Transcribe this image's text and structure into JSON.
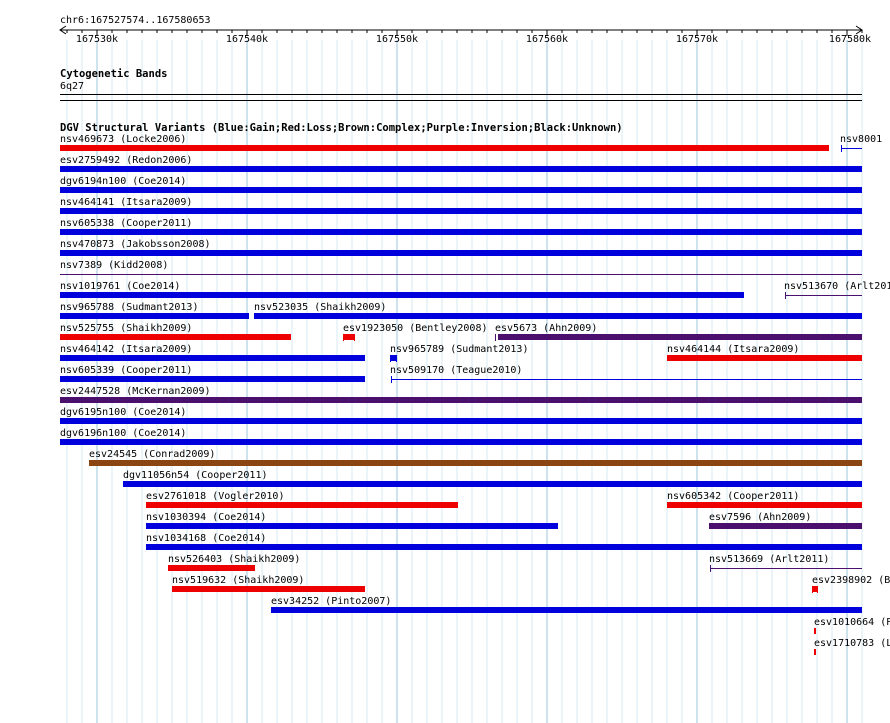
{
  "ruler": {
    "region": "chr6:167527574..167580653",
    "ticks": [
      "167530k",
      "167540k",
      "167550k",
      "167560k",
      "167570k",
      "167580k"
    ]
  },
  "cytoband": {
    "title": "Cytogenetic Bands",
    "band": "6q27"
  },
  "dgv": {
    "title": "DGV Structural Variants (Blue:Gain;Red:Loss;Brown:Complex;Purple:Inversion;Black:Unknown)",
    "features": [
      {
        "label": "nsv469673 (Locke2006)",
        "type": "loss"
      },
      {
        "label": "nsv8001",
        "type": "gain"
      },
      {
        "label": "esv2759492 (Redon2006)",
        "type": "gain"
      },
      {
        "label": "dgv6194n100 (Coe2014)",
        "type": "gain"
      },
      {
        "label": "nsv464141 (Itsara2009)",
        "type": "gain"
      },
      {
        "label": "nsv605338 (Cooper2011)",
        "type": "gain"
      },
      {
        "label": "nsv470873 (Jakobsson2008)",
        "type": "gain"
      },
      {
        "label": "nsv7389 (Kidd2008)",
        "type": "inversion"
      },
      {
        "label": "nsv1019761 (Coe2014)",
        "type": "gain"
      },
      {
        "label": "nsv513670 (Arlt201",
        "type": "inversion"
      },
      {
        "label": "nsv965788 (Sudmant2013)",
        "type": "gain"
      },
      {
        "label": "nsv523035 (Shaikh2009)",
        "type": "gain"
      },
      {
        "label": "nsv525755 (Shaikh2009)",
        "type": "loss"
      },
      {
        "label": "esv1923050 (Bentley2008)",
        "type": "loss"
      },
      {
        "label": "esv5673 (Ahn2009)",
        "type": "inversion"
      },
      {
        "label": "nsv464142 (Itsara2009)",
        "type": "gain"
      },
      {
        "label": "nsv965789 (Sudmant2013)",
        "type": "gain"
      },
      {
        "label": "nsv464144 (Itsara2009)",
        "type": "loss"
      },
      {
        "label": "nsv605339 (Cooper2011)",
        "type": "gain"
      },
      {
        "label": "nsv509170 (Teague2010)",
        "type": "gain"
      },
      {
        "label": "esv2447528 (McKernan2009)",
        "type": "inversion"
      },
      {
        "label": "dgv6195n100 (Coe2014)",
        "type": "gain"
      },
      {
        "label": "dgv6196n100 (Coe2014)",
        "type": "gain"
      },
      {
        "label": "esv24545 (Conrad2009)",
        "type": "complex"
      },
      {
        "label": "dgv11056n54 (Cooper2011)",
        "type": "gain"
      },
      {
        "label": "esv2761018 (Vogler2010)",
        "type": "loss"
      },
      {
        "label": "nsv605342 (Cooper2011)",
        "type": "loss"
      },
      {
        "label": "nsv1030394 (Coe2014)",
        "type": "gain"
      },
      {
        "label": "esv7596 (Ahn2009)",
        "type": "inversion"
      },
      {
        "label": "nsv1034168 (Coe2014)",
        "type": "gain"
      },
      {
        "label": "nsv526403 (Shaikh2009)",
        "type": "loss"
      },
      {
        "label": "nsv513669 (Arlt2011)",
        "type": "inversion"
      },
      {
        "label": "nsv519632 (Shaikh2009)",
        "type": "loss"
      },
      {
        "label": "esv2398902 (B",
        "type": "loss"
      },
      {
        "label": "esv34252 (Pinto2007)",
        "type": "gain"
      },
      {
        "label": "esv1010664 (P",
        "type": "loss"
      },
      {
        "label": "esv1710783 (L",
        "type": "loss"
      }
    ]
  },
  "colors": {
    "gain": "#0000dd",
    "loss": "#ee0000",
    "complex": "#8b4513",
    "inversion": "#4b0f6e",
    "grid_major": "#9fc7dd",
    "grid_minor": "#d7e9f3"
  }
}
